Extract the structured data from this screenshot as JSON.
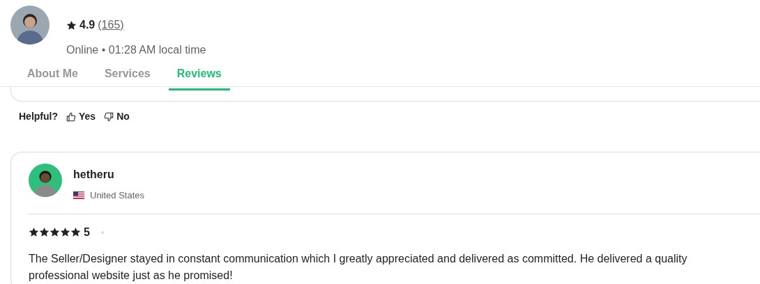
{
  "seller": {
    "rating": "4.9",
    "review_count": "(165)",
    "status": "Online • 01:28 AM local time"
  },
  "tabs": [
    {
      "label": "About Me",
      "selected": false
    },
    {
      "label": "Services",
      "selected": false
    },
    {
      "label": "Reviews",
      "selected": true
    }
  ],
  "helpful": {
    "label": "Helpful?",
    "yes": "Yes",
    "no": "No"
  },
  "review": {
    "username": "hetheru",
    "country": "United States",
    "stars": 5,
    "rating": "5",
    "text": "The Seller/Designer stayed in constant communication which I greatly appreciated and delivered as committed. He delivered a quality professional website just as he promised!"
  }
}
